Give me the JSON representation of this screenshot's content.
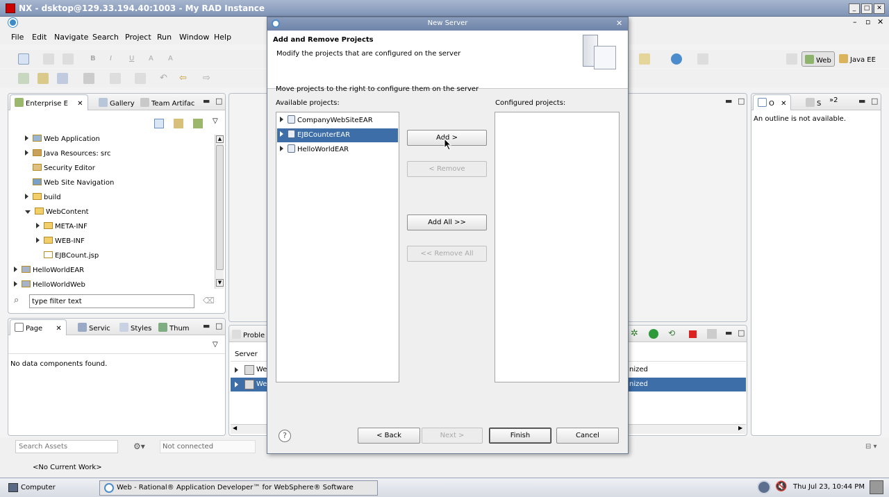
{
  "nx_window": {
    "title": "NX - dsktop@129.33.194.40:1003 - My RAD Instance"
  },
  "menu": [
    "File",
    "Edit",
    "Navigate",
    "Search",
    "Project",
    "Run",
    "Window",
    "Help"
  ],
  "perspectives": {
    "web": "Web",
    "java_ee": "Java EE"
  },
  "left_top_panel": {
    "tabs": [
      "Enterprise E",
      "Gallery",
      "Team Artifac"
    ],
    "tree": [
      {
        "label": "Web Application",
        "indent": 1,
        "arrow": "closed"
      },
      {
        "label": "Java Resources: src",
        "indent": 1,
        "arrow": "closed"
      },
      {
        "label": "Security Editor",
        "indent": 1,
        "arrow": "none"
      },
      {
        "label": "Web Site Navigation",
        "indent": 1,
        "arrow": "none"
      },
      {
        "label": "build",
        "indent": 1,
        "arrow": "closed"
      },
      {
        "label": "WebContent",
        "indent": 1,
        "arrow": "open"
      },
      {
        "label": "META-INF",
        "indent": 2,
        "arrow": "closed"
      },
      {
        "label": "WEB-INF",
        "indent": 2,
        "arrow": "closed"
      },
      {
        "label": "EJBCount.jsp",
        "indent": 2,
        "arrow": "none"
      },
      {
        "label": "HelloWorldEAR",
        "indent": 0,
        "arrow": "closed"
      },
      {
        "label": "HelloWorldWeb",
        "indent": 0,
        "arrow": "closed"
      }
    ],
    "filter_placeholder": "type filter text"
  },
  "left_bottom_panel": {
    "tabs": [
      "Page",
      "Servic",
      "Styles",
      "Thum"
    ],
    "message": "No data components found."
  },
  "right_panel": {
    "tabs": [
      "O",
      "S",
      "»2"
    ],
    "message": "An outline is not available."
  },
  "bottom_center_panel": {
    "tab": "Proble",
    "column": "Server",
    "rows": [
      {
        "label": "We",
        "status": "nized",
        "selected": false
      },
      {
        "label": "We",
        "status": "nized",
        "selected": true
      }
    ]
  },
  "status_bar": {
    "search_assets_placeholder": "Search Assets",
    "connection": "Not connected",
    "current_work": "<No Current Work>"
  },
  "dialog": {
    "title": "New Server",
    "heading": "Add and Remove Projects",
    "description": "Modify the projects that are configured on the server",
    "instruction": "Move projects to the right to configure them on the server",
    "available_label": "Available projects:",
    "configured_label": "Configured projects:",
    "available_projects": [
      {
        "label": "CompanyWebSiteEAR",
        "selected": false
      },
      {
        "label": "EJBCounterEAR",
        "selected": true
      },
      {
        "label": "HelloWorldEAR",
        "selected": false
      }
    ],
    "buttons": {
      "add": "Add >",
      "remove": "< Remove",
      "add_all": "Add All >>",
      "remove_all": "<< Remove All",
      "back": "< Back",
      "next": "Next >",
      "finish": "Finish",
      "cancel": "Cancel"
    }
  },
  "taskbar": {
    "computer": "Computer",
    "task": "Web - Rational® Application Developer™ for WebSphere® Software",
    "clock": "Thu Jul 23, 10:44 PM"
  }
}
